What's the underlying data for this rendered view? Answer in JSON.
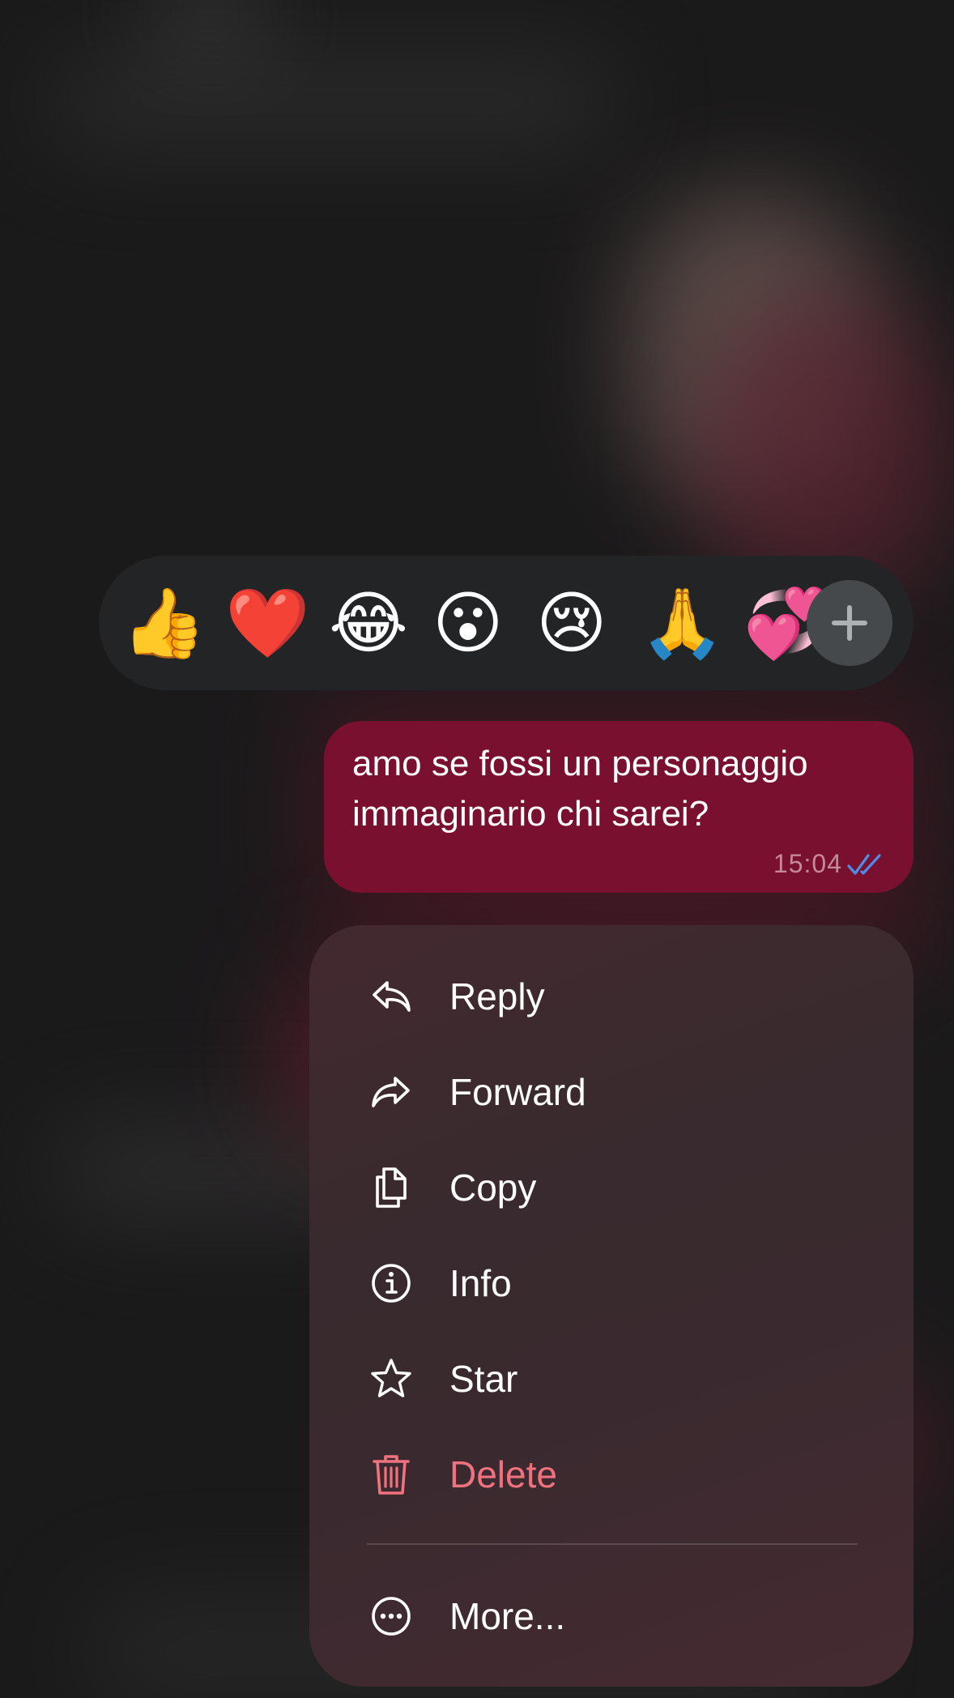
{
  "reactions": {
    "emojis": [
      "👍",
      "❤️",
      "😂",
      "😮",
      "😢",
      "🙏",
      "💞"
    ],
    "more_icon": "plus-icon"
  },
  "message": {
    "text": "amo se fossi un personaggio immaginario chi sarei?",
    "time": "15:04",
    "status_icon": "double-check-icon",
    "bubble_color": "#7a1030",
    "check_color": "#4d8de8"
  },
  "menu": {
    "items": [
      {
        "label": "Reply",
        "icon": "reply-icon"
      },
      {
        "label": "Forward",
        "icon": "forward-icon"
      },
      {
        "label": "Copy",
        "icon": "copy-icon"
      },
      {
        "label": "Info",
        "icon": "info-icon"
      },
      {
        "label": "Star",
        "icon": "star-icon"
      },
      {
        "label": "Delete",
        "icon": "trash-icon"
      },
      {
        "label": "More...",
        "icon": "more-icon"
      }
    ],
    "danger_color": "#f1727f"
  }
}
